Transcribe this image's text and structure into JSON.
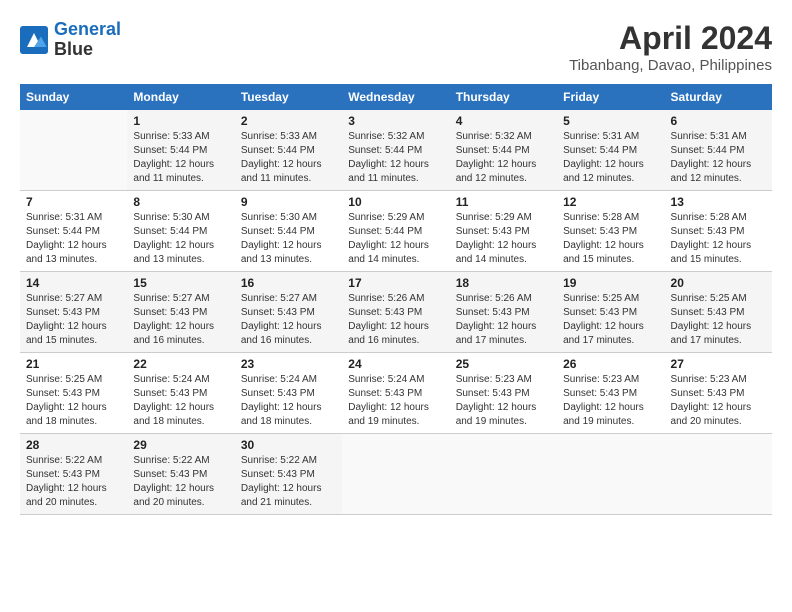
{
  "header": {
    "logo_line1": "General",
    "logo_line2": "Blue",
    "month": "April 2024",
    "location": "Tibanbang, Davao, Philippines"
  },
  "weekdays": [
    "Sunday",
    "Monday",
    "Tuesday",
    "Wednesday",
    "Thursday",
    "Friday",
    "Saturday"
  ],
  "weeks": [
    [
      {
        "num": "",
        "info": ""
      },
      {
        "num": "1",
        "info": "Sunrise: 5:33 AM\nSunset: 5:44 PM\nDaylight: 12 hours\nand 11 minutes."
      },
      {
        "num": "2",
        "info": "Sunrise: 5:33 AM\nSunset: 5:44 PM\nDaylight: 12 hours\nand 11 minutes."
      },
      {
        "num": "3",
        "info": "Sunrise: 5:32 AM\nSunset: 5:44 PM\nDaylight: 12 hours\nand 11 minutes."
      },
      {
        "num": "4",
        "info": "Sunrise: 5:32 AM\nSunset: 5:44 PM\nDaylight: 12 hours\nand 12 minutes."
      },
      {
        "num": "5",
        "info": "Sunrise: 5:31 AM\nSunset: 5:44 PM\nDaylight: 12 hours\nand 12 minutes."
      },
      {
        "num": "6",
        "info": "Sunrise: 5:31 AM\nSunset: 5:44 PM\nDaylight: 12 hours\nand 12 minutes."
      }
    ],
    [
      {
        "num": "7",
        "info": "Sunrise: 5:31 AM\nSunset: 5:44 PM\nDaylight: 12 hours\nand 13 minutes."
      },
      {
        "num": "8",
        "info": "Sunrise: 5:30 AM\nSunset: 5:44 PM\nDaylight: 12 hours\nand 13 minutes."
      },
      {
        "num": "9",
        "info": "Sunrise: 5:30 AM\nSunset: 5:44 PM\nDaylight: 12 hours\nand 13 minutes."
      },
      {
        "num": "10",
        "info": "Sunrise: 5:29 AM\nSunset: 5:44 PM\nDaylight: 12 hours\nand 14 minutes."
      },
      {
        "num": "11",
        "info": "Sunrise: 5:29 AM\nSunset: 5:43 PM\nDaylight: 12 hours\nand 14 minutes."
      },
      {
        "num": "12",
        "info": "Sunrise: 5:28 AM\nSunset: 5:43 PM\nDaylight: 12 hours\nand 15 minutes."
      },
      {
        "num": "13",
        "info": "Sunrise: 5:28 AM\nSunset: 5:43 PM\nDaylight: 12 hours\nand 15 minutes."
      }
    ],
    [
      {
        "num": "14",
        "info": "Sunrise: 5:27 AM\nSunset: 5:43 PM\nDaylight: 12 hours\nand 15 minutes."
      },
      {
        "num": "15",
        "info": "Sunrise: 5:27 AM\nSunset: 5:43 PM\nDaylight: 12 hours\nand 16 minutes."
      },
      {
        "num": "16",
        "info": "Sunrise: 5:27 AM\nSunset: 5:43 PM\nDaylight: 12 hours\nand 16 minutes."
      },
      {
        "num": "17",
        "info": "Sunrise: 5:26 AM\nSunset: 5:43 PM\nDaylight: 12 hours\nand 16 minutes."
      },
      {
        "num": "18",
        "info": "Sunrise: 5:26 AM\nSunset: 5:43 PM\nDaylight: 12 hours\nand 17 minutes."
      },
      {
        "num": "19",
        "info": "Sunrise: 5:25 AM\nSunset: 5:43 PM\nDaylight: 12 hours\nand 17 minutes."
      },
      {
        "num": "20",
        "info": "Sunrise: 5:25 AM\nSunset: 5:43 PM\nDaylight: 12 hours\nand 17 minutes."
      }
    ],
    [
      {
        "num": "21",
        "info": "Sunrise: 5:25 AM\nSunset: 5:43 PM\nDaylight: 12 hours\nand 18 minutes."
      },
      {
        "num": "22",
        "info": "Sunrise: 5:24 AM\nSunset: 5:43 PM\nDaylight: 12 hours\nand 18 minutes."
      },
      {
        "num": "23",
        "info": "Sunrise: 5:24 AM\nSunset: 5:43 PM\nDaylight: 12 hours\nand 18 minutes."
      },
      {
        "num": "24",
        "info": "Sunrise: 5:24 AM\nSunset: 5:43 PM\nDaylight: 12 hours\nand 19 minutes."
      },
      {
        "num": "25",
        "info": "Sunrise: 5:23 AM\nSunset: 5:43 PM\nDaylight: 12 hours\nand 19 minutes."
      },
      {
        "num": "26",
        "info": "Sunrise: 5:23 AM\nSunset: 5:43 PM\nDaylight: 12 hours\nand 19 minutes."
      },
      {
        "num": "27",
        "info": "Sunrise: 5:23 AM\nSunset: 5:43 PM\nDaylight: 12 hours\nand 20 minutes."
      }
    ],
    [
      {
        "num": "28",
        "info": "Sunrise: 5:22 AM\nSunset: 5:43 PM\nDaylight: 12 hours\nand 20 minutes."
      },
      {
        "num": "29",
        "info": "Sunrise: 5:22 AM\nSunset: 5:43 PM\nDaylight: 12 hours\nand 20 minutes."
      },
      {
        "num": "30",
        "info": "Sunrise: 5:22 AM\nSunset: 5:43 PM\nDaylight: 12 hours\nand 21 minutes."
      },
      {
        "num": "",
        "info": ""
      },
      {
        "num": "",
        "info": ""
      },
      {
        "num": "",
        "info": ""
      },
      {
        "num": "",
        "info": ""
      }
    ]
  ]
}
